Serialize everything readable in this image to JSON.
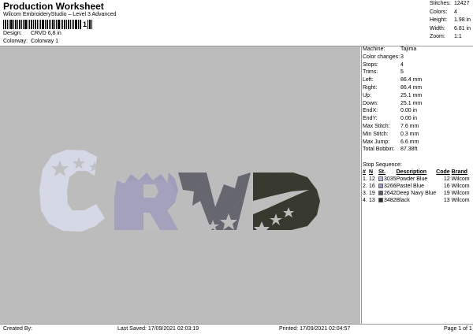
{
  "header": {
    "title": "Production Worksheet",
    "subtitle": "Wilcom EmbroideryStudio – Level 3 Advanced",
    "barcode_text": "1"
  },
  "design": {
    "label": "Design:",
    "value": "CRVD 6,8 in"
  },
  "colorway": {
    "label": "Colorway:",
    "value": "Colorway 1"
  },
  "stats": [
    {
      "label": "Stitches:",
      "value": "12427"
    },
    {
      "label": "Colors:",
      "value": "4"
    },
    {
      "label": "Height:",
      "value": "1.98 in"
    },
    {
      "label": "Width:",
      "value": "6.81 in"
    },
    {
      "label": "Zoom:",
      "value": "1:1"
    }
  ],
  "info": [
    {
      "label": "Machine:",
      "value": "Tajima"
    },
    {
      "label": "Color changes:",
      "value": "3"
    },
    {
      "label": "Stops:",
      "value": "4"
    },
    {
      "label": "Trims:",
      "value": "5"
    },
    {
      "label": "Left:",
      "value": "86.4 mm"
    },
    {
      "label": "Right:",
      "value": "86.4 mm"
    },
    {
      "label": "Up:",
      "value": "25.1 mm"
    },
    {
      "label": "Down:",
      "value": "25.1 mm"
    },
    {
      "label": "EndX:",
      "value": "0.00 in"
    },
    {
      "label": "EndY:",
      "value": "0.00 in"
    },
    {
      "label": "Max Stitch:",
      "value": "7.6 mm"
    },
    {
      "label": "Min Stitch:",
      "value": "0.3 mm"
    },
    {
      "label": "Max Jump:",
      "value": "6.6 mm"
    },
    {
      "label": "Total Bobbin:",
      "value": "87.38ft"
    }
  ],
  "stop_sequence": {
    "title": "Stop Sequence:",
    "headers": {
      "num": "#",
      "n": "N",
      "st": "St.",
      "desc": "Description",
      "code": "Code",
      "brand": "Brand"
    },
    "rows": [
      {
        "num": "1.",
        "n": "12",
        "st": "3035",
        "desc": "Powder Blue",
        "code": "12",
        "brand": "Wilcom",
        "color": "#b6bde0"
      },
      {
        "num": "2.",
        "n": "16",
        "st": "3266",
        "desc": "Pastel Blue",
        "code": "16",
        "brand": "Wilcom",
        "color": "#9c9ac4"
      },
      {
        "num": "3.",
        "n": "19",
        "st": "2642",
        "desc": "Deep Navy Blue",
        "code": "19",
        "brand": "Wilcom",
        "color": "#5b5b67"
      },
      {
        "num": "4.",
        "n": "13",
        "st": "3482",
        "desc": "Black",
        "code": "13",
        "brand": "Wilcom",
        "color": "#2f3126"
      }
    ]
  },
  "footer": {
    "created_by": "Created By:",
    "last_saved": "Last Saved: 17/09/2021 02:03:19",
    "printed": "Printed: 17/09/2021 02:04:57",
    "page": "Page 1 of 1"
  },
  "colors": {
    "letter_c": "#d3d6e4",
    "letter_r": "#9f9db9",
    "letter_v": "#5f5f69",
    "letter_d": "#34362b"
  }
}
